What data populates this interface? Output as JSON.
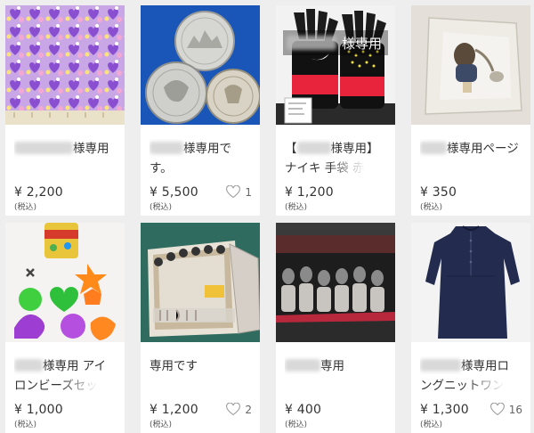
{
  "items": [
    {
      "title_pre": "",
      "title_post": "様専用",
      "price": "¥ 2,200",
      "tax": "(税込)",
      "likes": ""
    },
    {
      "title_pre": "",
      "title_post": "様専用です。",
      "price": "¥ 5,500",
      "tax": "(税込)",
      "likes": "1"
    },
    {
      "title_pre": "【",
      "title_post": "様専用】",
      "title_line2": "ナイキ 手袋 赤",
      "price": "¥ 1,200",
      "tax": "(税込)",
      "likes": "",
      "overlay": "様専用"
    },
    {
      "title_pre": "",
      "title_post": "様専用ページ",
      "price": "¥ 350",
      "tax": "(税込)",
      "likes": ""
    },
    {
      "title_pre": "",
      "title_post": "様専用 アイ",
      "title_line2": "ロンビーズセッ",
      "price": "¥ 1,000",
      "tax": "(税込)",
      "likes": ""
    },
    {
      "title_pre": "",
      "title_post": "専用です",
      "price": "¥ 1,200",
      "tax": "(税込)",
      "likes": "2"
    },
    {
      "title_pre": "",
      "title_post": "専用",
      "price": "¥ 400",
      "tax": "(税込)",
      "likes": ""
    },
    {
      "title_pre": "",
      "title_post": "様専用ロ",
      "title_line2": "ングニットワン",
      "price": "¥ 1,300",
      "tax": "(税込)",
      "likes": "16"
    }
  ],
  "icons": {
    "like": "heart-outline-icon"
  }
}
